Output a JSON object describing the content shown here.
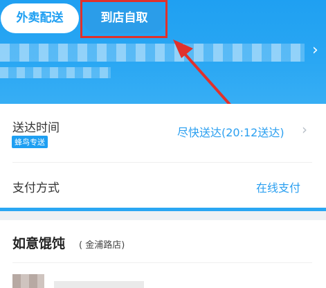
{
  "tabs": {
    "delivery_label": "外卖配送",
    "pickup_label": "到店自取"
  },
  "delivery": {
    "time_label": "送达时间",
    "badge": "蜂鸟专送",
    "time_value": "尽快送达(20:12送达)",
    "payment_label": "支付方式",
    "payment_value": "在线支付"
  },
  "shop": {
    "name": "如意馄饨",
    "branch": "( 金浦路店)"
  },
  "icons": {
    "chevron": "chevron-right-icon"
  },
  "colors": {
    "accent": "#1e9ff2",
    "annotation": "#e0312c"
  }
}
